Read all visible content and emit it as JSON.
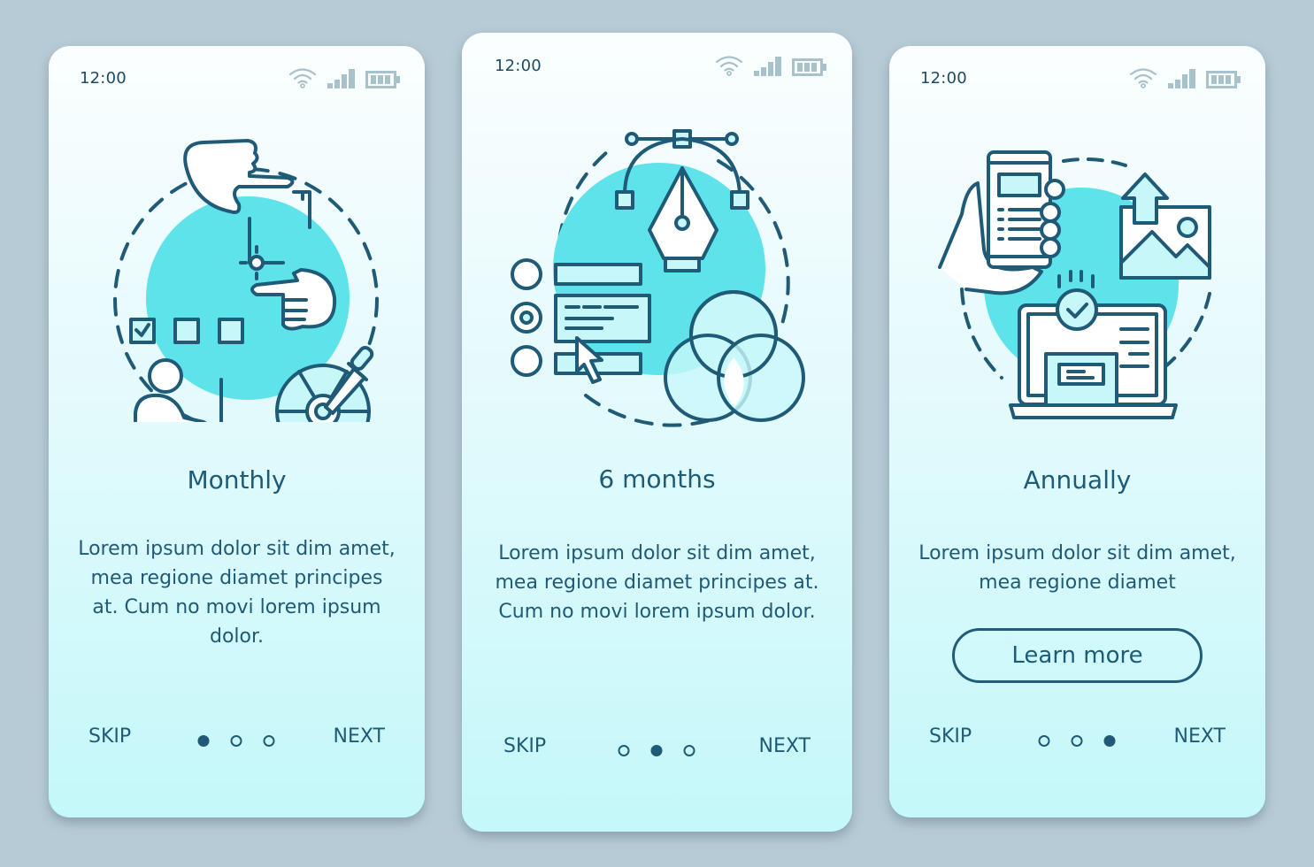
{
  "colors": {
    "background": "#b6cbd5",
    "accent": "#1f5a77",
    "highlight_circle": "#5fe3ea",
    "icon_fill_light": "#c8f7fa",
    "status_icons": "#a8c2cc"
  },
  "screens": [
    {
      "status": {
        "time": "12:00",
        "icons": [
          "wifi-icon",
          "signal-icon",
          "battery-icon"
        ]
      },
      "illustration": "design-tools-illustration",
      "title": "Monthly",
      "description": "Lorem ipsum dolor sit dim amet, mea regione diamet principes at. Cum no movi lorem ipsum dolor.",
      "nav": {
        "skip": "SKIP",
        "next": "NEXT",
        "page_count": 3,
        "active_page": 1
      }
    },
    {
      "status": {
        "time": "12:00",
        "icons": [
          "wifi-icon",
          "signal-icon",
          "battery-icon"
        ]
      },
      "illustration": "vector-design-illustration",
      "title": "6 months",
      "description": "Lorem ipsum dolor sit dim amet, mea regione diamet principes at. Cum no movi lorem ipsum dolor.",
      "nav": {
        "skip": "SKIP",
        "next": "NEXT",
        "page_count": 3,
        "active_page": 2
      }
    },
    {
      "status": {
        "time": "12:00",
        "icons": [
          "wifi-icon",
          "signal-icon",
          "battery-icon"
        ]
      },
      "illustration": "publishing-illustration",
      "title": "Annually",
      "description": "Lorem ipsum dolor sit dim amet, mea regione diamet",
      "button": "Learn more",
      "nav": {
        "skip": "SKIP",
        "next": "NEXT",
        "page_count": 3,
        "active_page": 3
      }
    }
  ]
}
